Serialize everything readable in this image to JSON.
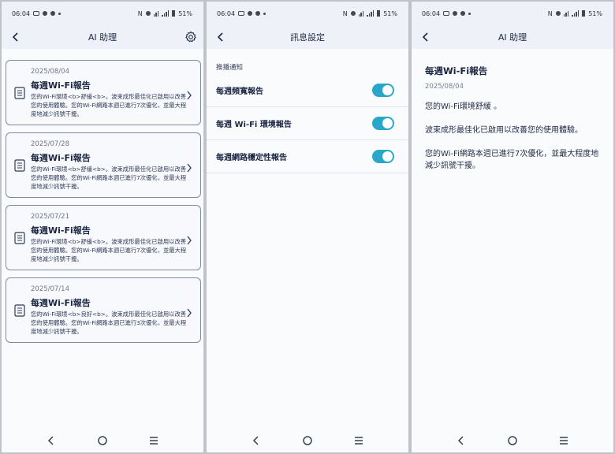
{
  "status": {
    "time": "06:04",
    "battery": "51%",
    "nfc": "N"
  },
  "screens": {
    "list": {
      "title": "AI 助理",
      "cards": [
        {
          "date": "2025/08/04",
          "title": "每週Wi-Fi報告",
          "summary": "您的Wi-Fi環境<b>舒緩<b>。波束成形最佳化已啟用以改善您的使用體驗。您的Wi-Fi網路本週已進行7次優化，並最大程度地減少訊號干擾。"
        },
        {
          "date": "2025/07/28",
          "title": "每週Wi-Fi報告",
          "summary": "您的Wi-Fi環境<b>舒緩<b>。波束成形最佳化已啟用以改善您的使用體驗。您的Wi-Fi網路本週已進行7次優化，並最大程度地減少訊號干擾。"
        },
        {
          "date": "2025/07/21",
          "title": "每週Wi-Fi報告",
          "summary": "您的Wi-Fi環境<b>舒緩<b>。波束成形最佳化已啟用以改善您的使用體驗。您的Wi-Fi網路本週已進行7次優化，並最大程度地減少訊號干擾。"
        },
        {
          "date": "2025/07/14",
          "title": "每週Wi-Fi報告",
          "summary": "您的Wi-Fi環境<b>良好<b>。波束成形最佳化已啟用以改善您的使用體驗。您的Wi-Fi網路本週已進行3次優化，並最大程度地減少訊號干擾。"
        }
      ]
    },
    "settings": {
      "title": "訊息設定",
      "section_label": "推播通知",
      "toggles": [
        {
          "label": "每週頻寬報告",
          "on": true
        },
        {
          "label": "每週 Wi-Fi 環境報告",
          "on": true
        },
        {
          "label": "每週網路穩定性報告",
          "on": true
        }
      ]
    },
    "detail": {
      "title": "AI 助理",
      "report_title": "每週Wi-Fi報告",
      "date": "2025/08/04",
      "paragraphs": [
        "您的Wi-Fi環境舒緩 。",
        "波束成形最佳化已啟用以改善您的使用體驗。",
        "您的Wi-Fi網路本週已進行7次優化，並最大程度地減少訊號干擾。"
      ]
    }
  },
  "colors": {
    "accent": "#2aa7c8",
    "card_border": "#7a8aa8",
    "text": "#1c2742"
  },
  "icons": [
    "back-arrow-icon",
    "gear-icon",
    "document-icon",
    "chevron-right-icon",
    "nav-back-icon",
    "nav-home-icon",
    "nav-recents-icon"
  ]
}
